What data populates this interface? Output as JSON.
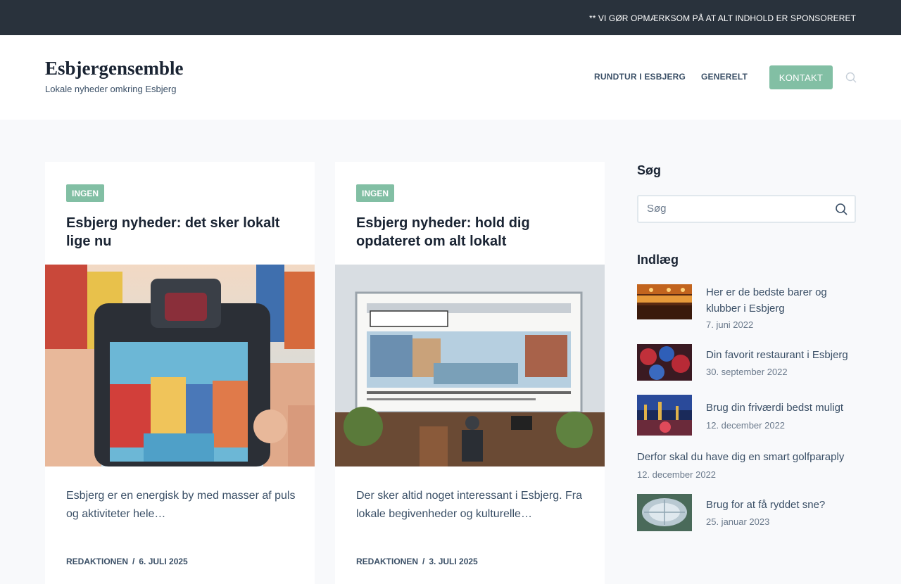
{
  "topbar": {
    "notice": "** VI GØR OPMÆRKSOM PÅ AT ALT INDHOLD ER SPONSORERET"
  },
  "header": {
    "site_title": "Esbjergensemble",
    "tagline": "Lokale nyheder omkring Esbjerg",
    "nav": [
      "RUNDTUR I ESBJERG",
      "GENERELT"
    ],
    "contact_label": "KONTAKT",
    "search_icon": "search-icon"
  },
  "posts": [
    {
      "category": "INGEN",
      "title": "Esbjerg nyheder: det sker lokalt lige nu",
      "excerpt": "Esbjerg er en energisk by med masser af puls og aktiviteter hele…",
      "author": "REDAKTIONEN",
      "date": "6. JULI 2025"
    },
    {
      "category": "INGEN",
      "title": "Esbjerg nyheder: hold dig opdateret om alt lokalt",
      "excerpt": "Der sker altid noget interessant i Esbjerg. Fra lokale begivenheder og kulturelle…",
      "author": "REDAKTIONEN",
      "date": "3. JULI 2025"
    }
  ],
  "sidebar": {
    "search_heading": "Søg",
    "search_placeholder": "Søg",
    "posts_heading": "Indlæg",
    "posts": [
      {
        "title": "Her er de bedste barer og klubber i Esbjerg",
        "date": "7. juni 2022"
      },
      {
        "title": "Din favorit restaurant i Esbjerg",
        "date": "30. september 2022"
      },
      {
        "title": "Brug din friværdi bedst muligt",
        "date": "12. december 2022"
      },
      {
        "title": "Derfor skal du have dig en smart golfparaply",
        "date": "12. december 2022"
      },
      {
        "title": "Brug for at få ryddet sne?",
        "date": "25. januar 2023"
      }
    ]
  },
  "colors": {
    "accent": "#82bfa4",
    "topbar": "#29323c",
    "heading": "#1a2433",
    "text": "#3a4f66"
  }
}
